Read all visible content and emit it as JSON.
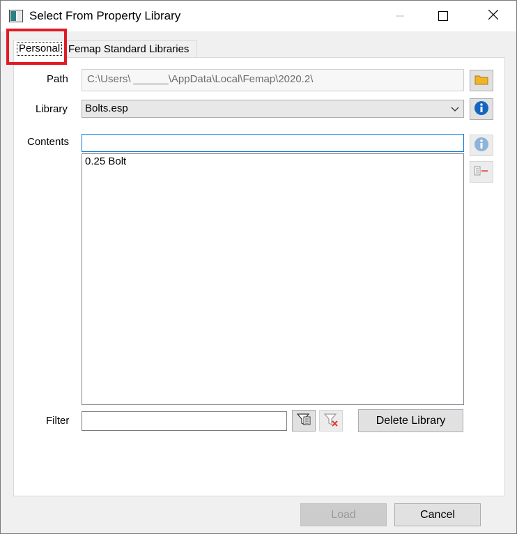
{
  "window": {
    "title": "Select From Property Library",
    "icon": "app-window-icon"
  },
  "tabs": [
    {
      "label": "Personal",
      "selected": true
    },
    {
      "label": "Femap Standard Libraries",
      "selected": false
    }
  ],
  "form": {
    "path_label": "Path",
    "path_value": "C:\\Users\\ ______\\AppData\\Local\\Femap\\2020.2\\",
    "library_label": "Library",
    "library_value": "Bolts.esp",
    "contents_label": "Contents",
    "contents_input_value": "",
    "contents_items": [
      "0.25 Bolt"
    ],
    "filter_label": "Filter",
    "filter_value": ""
  },
  "buttons": {
    "delete_library": "Delete Library",
    "load": "Load",
    "cancel": "Cancel"
  },
  "icons": {
    "browse": "folder-icon",
    "library_info": "info-icon",
    "contents_info": "info-icon",
    "remove": "remove-entry-icon",
    "filter": "filter-icon",
    "clear_filter": "clear-filter-icon"
  },
  "colors": {
    "highlight": "#e01b24",
    "focus_border": "#0a78d7",
    "info_blue": "#1565c0",
    "folder": "#f0b429"
  }
}
